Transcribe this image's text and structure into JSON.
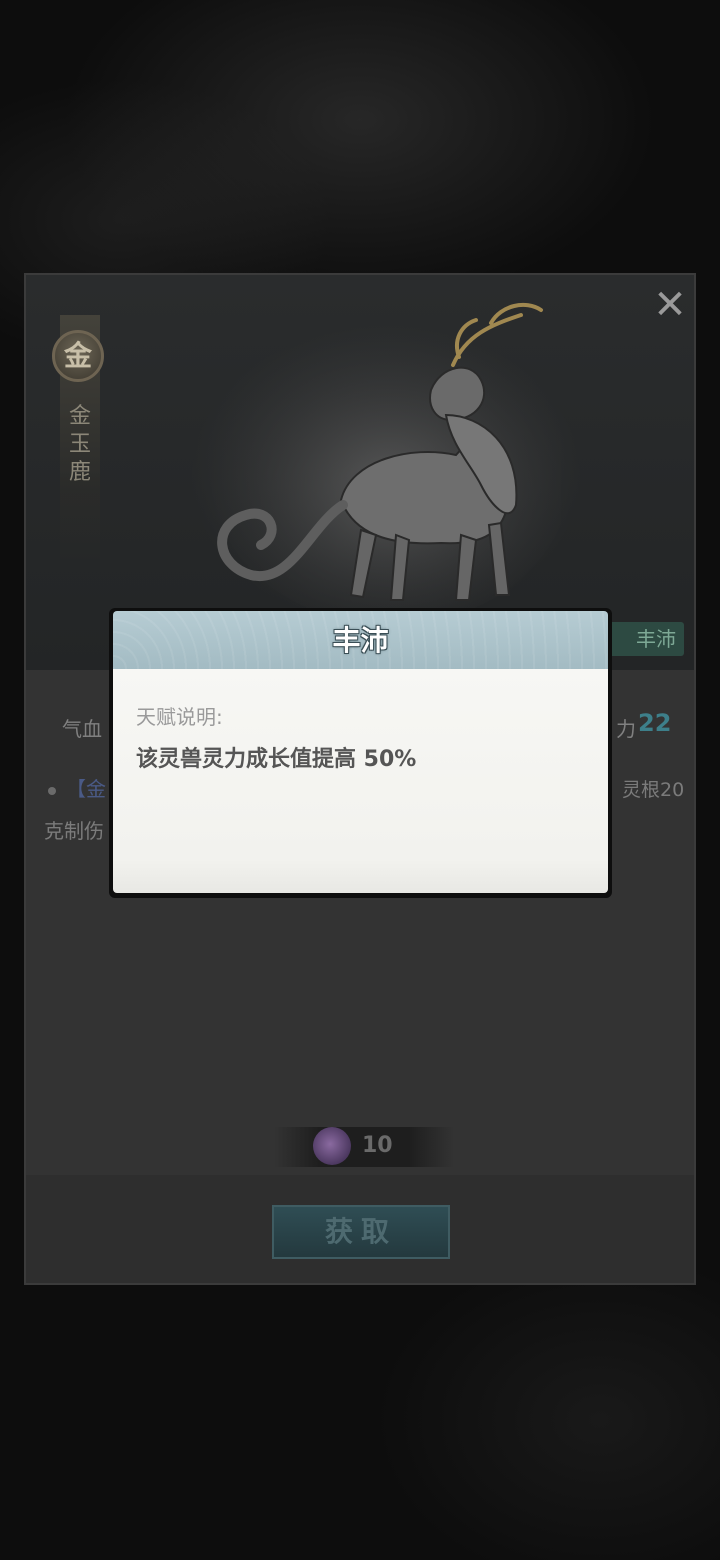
{
  "beast": {
    "element_badge": "金",
    "name_chars": [
      "金",
      "玉",
      "鹿"
    ],
    "talent_tag": "丰沛"
  },
  "stats": {
    "left_label": "气血",
    "right_label": "力",
    "right_value": "22"
  },
  "skill": {
    "prefix": "【金",
    "root_text": "灵根20",
    "counter_text": "克制伤"
  },
  "cost": {
    "icon": "purple-flower-currency-icon",
    "value": "10"
  },
  "actions": {
    "obtain_label": "获取",
    "close_icon": "close-x-icon"
  },
  "popup": {
    "title": "丰沛",
    "desc_label": "天赋说明:",
    "desc_text": "该灵兽灵力成长值提高 50%"
  },
  "colors": {
    "accent_teal": "#3d7f8a",
    "popup_header": "#b6ccd3",
    "button_bg": "#2f4d54"
  }
}
